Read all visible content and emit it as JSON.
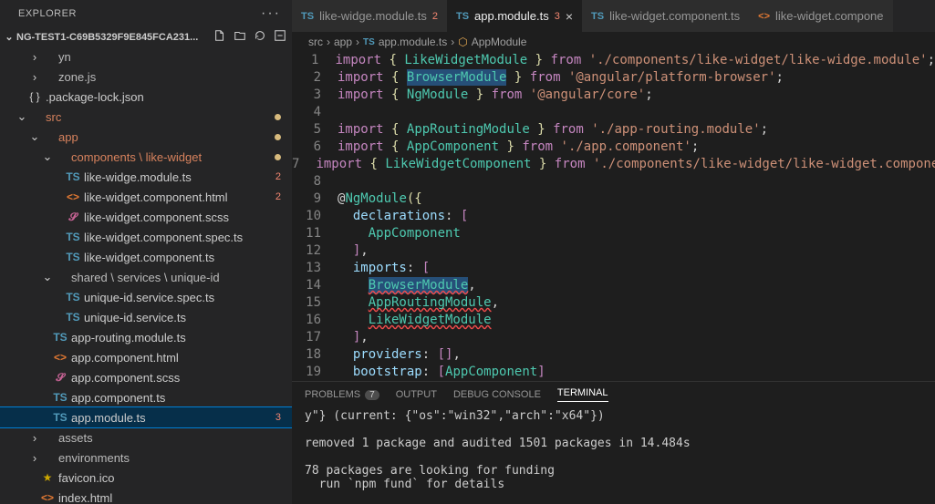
{
  "sidebar": {
    "title": "EXPLORER",
    "project": "NG-TEST1-C69B5329F9E845FCA231...",
    "tree": [
      {
        "d": 1,
        "chev": ">",
        "icon": "",
        "cls": "fold-gray",
        "lbl": "yn"
      },
      {
        "d": 1,
        "chev": ">",
        "icon": "",
        "cls": "fold-gray",
        "lbl": "zone.js"
      },
      {
        "d": 0,
        "icon": "{ }",
        "cls": "ic-json",
        "lbl": ".package-lock.json"
      },
      {
        "d": 0,
        "chev": "v",
        "icon": "",
        "cls": "fold-orange",
        "lbl": "src",
        "dot": true
      },
      {
        "d": 1,
        "chev": "v",
        "icon": "",
        "cls": "fold-orange",
        "lbl": "app",
        "dot": true
      },
      {
        "d": 2,
        "chev": "v",
        "icon": "",
        "cls": "fold-orange",
        "lbl": "components \\ like-widget",
        "dot": true
      },
      {
        "d": 3,
        "icon": "TS",
        "cls": "ic-ts",
        "lbl": "like-widge.module.ts",
        "badge": "2"
      },
      {
        "d": 3,
        "icon": "<>",
        "cls": "ic-html",
        "lbl": "like-widget.component.html",
        "badge": "2"
      },
      {
        "d": 3,
        "icon": "𝓢",
        "cls": "ic-scss",
        "lbl": "like-widget.component.scss"
      },
      {
        "d": 3,
        "icon": "TS",
        "cls": "ic-ts",
        "lbl": "like-widget.component.spec.ts"
      },
      {
        "d": 3,
        "icon": "TS",
        "cls": "ic-ts",
        "lbl": "like-widget.component.ts"
      },
      {
        "d": 2,
        "chev": "v",
        "icon": "",
        "cls": "fold-gray",
        "lbl": "shared \\ services \\ unique-id"
      },
      {
        "d": 3,
        "icon": "TS",
        "cls": "ic-ts",
        "lbl": "unique-id.service.spec.ts"
      },
      {
        "d": 3,
        "icon": "TS",
        "cls": "ic-ts",
        "lbl": "unique-id.service.ts"
      },
      {
        "d": 2,
        "icon": "TS",
        "cls": "ic-ts",
        "lbl": "app-routing.module.ts"
      },
      {
        "d": 2,
        "icon": "<>",
        "cls": "ic-html",
        "lbl": "app.component.html"
      },
      {
        "d": 2,
        "icon": "𝓢",
        "cls": "ic-scss",
        "lbl": "app.component.scss"
      },
      {
        "d": 2,
        "icon": "TS",
        "cls": "ic-ts",
        "lbl": "app.component.ts"
      },
      {
        "d": 2,
        "icon": "TS",
        "cls": "ic-ts",
        "lbl": "app.module.ts",
        "badge": "3",
        "sel": true
      },
      {
        "d": 1,
        "chev": ">",
        "icon": "",
        "cls": "fold-gray",
        "lbl": "assets"
      },
      {
        "d": 1,
        "chev": ">",
        "icon": "",
        "cls": "fold-gray",
        "lbl": "environments"
      },
      {
        "d": 1,
        "icon": "★",
        "cls": "ic-star",
        "lbl": "favicon.ico"
      },
      {
        "d": 1,
        "icon": "<>",
        "cls": "ic-html",
        "lbl": "index.html"
      }
    ]
  },
  "tabs": [
    {
      "icon": "TS",
      "iconCls": "ic-ts",
      "lbl": "like-widge.module.ts",
      "badge": "2"
    },
    {
      "icon": "TS",
      "iconCls": "ic-ts",
      "lbl": "app.module.ts",
      "badge": "3",
      "act": true,
      "close": true
    },
    {
      "icon": "TS",
      "iconCls": "ic-ts",
      "lbl": "like-widget.component.ts"
    },
    {
      "icon": "<>",
      "iconCls": "ic-html",
      "lbl": "like-widget.compone"
    }
  ],
  "crumb": [
    "src",
    "app",
    "app.module.ts",
    "AppModule"
  ],
  "code": [
    {
      "n": 1,
      "h": "<span class='k-pink'>import</span> <span class='k-yel'>{</span> <span class='k-grn'>LikeWidgetModule</span> <span class='k-yel'>}</span> <span class='k-pink'>from</span> <span class='k-str'>'./components/like-widget/like-widge.module'</span><span class='k-wht'>;</span>"
    },
    {
      "n": 2,
      "h": "<span class='k-pink'>import</span> <span class='k-yel'>{</span> <span class='k-grn sel-bg'>BrowserModule</span> <span class='k-yel'>}</span> <span class='k-pink'>from</span> <span class='k-str'>'@angular/platform-browser'</span><span class='k-wht'>;</span>"
    },
    {
      "n": 3,
      "h": "<span class='k-pink'>import</span> <span class='k-yel'>{</span> <span class='k-grn'>NgModule</span> <span class='k-yel'>}</span> <span class='k-pink'>from</span> <span class='k-str'>'@angular/core'</span><span class='k-wht'>;</span>"
    },
    {
      "n": 4,
      "h": ""
    },
    {
      "n": 5,
      "h": "<span class='k-pink'>import</span> <span class='k-yel'>{</span> <span class='k-grn'>AppRoutingModule</span> <span class='k-yel'>}</span> <span class='k-pink'>from</span> <span class='k-str'>'./app-routing.module'</span><span class='k-wht'>;</span>"
    },
    {
      "n": 6,
      "h": "<span class='k-pink'>import</span> <span class='k-yel'>{</span> <span class='k-grn'>AppComponent</span> <span class='k-yel'>}</span> <span class='k-pink'>from</span> <span class='k-str'>'./app.component'</span><span class='k-wht'>;</span>"
    },
    {
      "n": 7,
      "h": "<span class='k-pink'>import</span> <span class='k-yel'>{</span> <span class='k-grn'>LikeWidgetComponent</span> <span class='k-yel'>}</span> <span class='k-pink'>from</span> <span class='k-str'>'./components/like-widget/like-widget.component</span>"
    },
    {
      "n": 8,
      "h": ""
    },
    {
      "n": 9,
      "h": "<span class='k-wht'>@</span><span class='k-grn'>NgModule</span><span class='k-yel'>({</span>"
    },
    {
      "n": 10,
      "h": "  <span class='k-blu'>declarations</span><span class='k-wht'>:</span> <span class='k-pink'>[</span>"
    },
    {
      "n": 11,
      "h": "    <span class='k-grn'>AppComponent</span>"
    },
    {
      "n": 12,
      "h": "  <span class='k-pink'>]</span><span class='k-wht'>,</span>"
    },
    {
      "n": 13,
      "h": "  <span class='k-blu'>imports</span><span class='k-wht'>:</span> <span class='k-pink'>[</span>"
    },
    {
      "n": 14,
      "h": "    <span class='k-grn sel-bg squig'>BrowserModule</span><span class='k-wht'>,</span>"
    },
    {
      "n": 15,
      "h": "    <span class='k-grn squig'>AppRoutingModule</span><span class='k-wht'>,</span>"
    },
    {
      "n": 16,
      "h": "    <span class='k-grn squig'>LikeWidgetModule</span>"
    },
    {
      "n": 17,
      "h": "  <span class='k-pink'>]</span><span class='k-wht'>,</span>"
    },
    {
      "n": 18,
      "h": "  <span class='k-blu'>providers</span><span class='k-wht'>:</span> <span class='k-pink'>[]</span><span class='k-wht'>,</span>"
    },
    {
      "n": 19,
      "h": "  <span class='k-blu'>bootstrap</span><span class='k-wht'>:</span> <span class='k-pink'>[</span><span class='k-grn'>AppComponent</span><span class='k-pink'>]</span>"
    }
  ],
  "panel": {
    "tabs": [
      {
        "lbl": "PROBLEMS",
        "badge": "7"
      },
      {
        "lbl": "OUTPUT"
      },
      {
        "lbl": "DEBUG CONSOLE"
      },
      {
        "lbl": "TERMINAL",
        "act": true
      }
    ],
    "output": "y\"} (current: {\"os\":\"win32\",\"arch\":\"x64\"})\n\nremoved 1 package and audited 1501 packages in 14.484s\n\n78 packages are looking for funding\n  run `npm fund` for details"
  }
}
